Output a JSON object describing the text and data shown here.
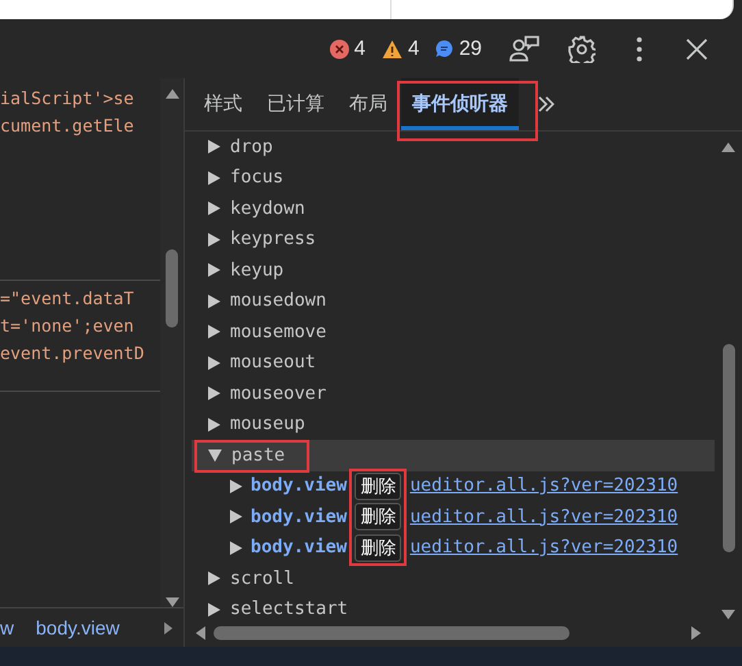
{
  "toolbar": {
    "errors": "4",
    "warnings": "4",
    "messages": "29"
  },
  "code_upper": [
    "ialScript'>se",
    "cument.getEle"
  ],
  "code_lower": [
    "=\"event.dataT",
    "t='none';even",
    "event.preventD"
  ],
  "breadcrumbs": [
    "w",
    "body.view"
  ],
  "tabs": [
    {
      "label": "样式",
      "selected": false,
      "highlighted": false
    },
    {
      "label": "已计算",
      "selected": false,
      "highlighted": false
    },
    {
      "label": "布局",
      "selected": false,
      "highlighted": false
    },
    {
      "label": "事件侦听器",
      "selected": true,
      "highlighted": true
    }
  ],
  "events": [
    {
      "name": "drop",
      "expanded": false,
      "selected": false,
      "highlighted": false
    },
    {
      "name": "focus",
      "expanded": false,
      "selected": false,
      "highlighted": false
    },
    {
      "name": "keydown",
      "expanded": false,
      "selected": false,
      "highlighted": false
    },
    {
      "name": "keypress",
      "expanded": false,
      "selected": false,
      "highlighted": false
    },
    {
      "name": "keyup",
      "expanded": false,
      "selected": false,
      "highlighted": false
    },
    {
      "name": "mousedown",
      "expanded": false,
      "selected": false,
      "highlighted": false
    },
    {
      "name": "mousemove",
      "expanded": false,
      "selected": false,
      "highlighted": false
    },
    {
      "name": "mouseout",
      "expanded": false,
      "selected": false,
      "highlighted": false
    },
    {
      "name": "mouseover",
      "expanded": false,
      "selected": false,
      "highlighted": false
    },
    {
      "name": "mouseup",
      "expanded": false,
      "selected": false,
      "highlighted": false
    },
    {
      "name": "paste",
      "expanded": true,
      "selected": true,
      "highlighted": true,
      "remove_buttons_highlighted": true,
      "listeners": [
        {
          "node": "body.view",
          "remove_label": "删除",
          "source": "ueditor.all.js?ver=202310"
        },
        {
          "node": "body.view",
          "remove_label": "删除",
          "source": "ueditor.all.js?ver=202310"
        },
        {
          "node": "body.view",
          "remove_label": "删除",
          "source": "ueditor.all.js?ver=202310"
        }
      ]
    },
    {
      "name": "scroll",
      "expanded": false,
      "selected": false,
      "highlighted": false
    },
    {
      "name": "selectstart",
      "expanded": false,
      "selected": false,
      "highlighted": false
    }
  ]
}
